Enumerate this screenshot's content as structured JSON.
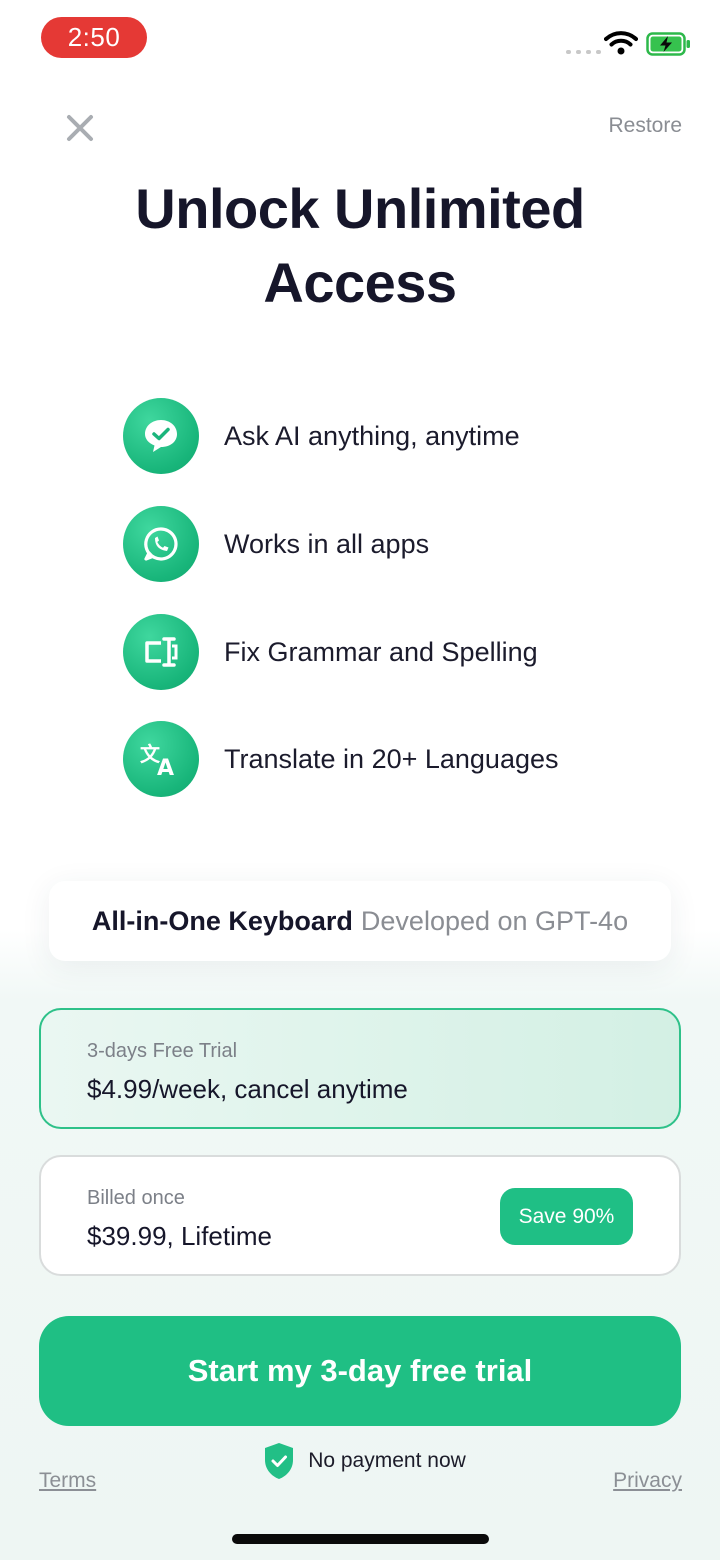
{
  "status_bar": {
    "time": "2:50",
    "wifi_icon": "wifi-icon",
    "battery_icon": "battery-charging-icon"
  },
  "header": {
    "close_icon": "close-icon",
    "restore_label": "Restore"
  },
  "title": "Unlock Unlimited Access",
  "features": [
    {
      "icon": "chat-check-icon",
      "label": "Ask AI anything, anytime"
    },
    {
      "icon": "whatsapp-icon",
      "label": "Works in all apps"
    },
    {
      "icon": "text-cursor-icon",
      "label": "Fix Grammar and Spelling"
    },
    {
      "icon": "translate-icon",
      "label": "Translate in 20+ Languages"
    }
  ],
  "banner": {
    "bold": "All-in-One Keyboard",
    "light": "Developed on GPT-4o"
  },
  "plans": [
    {
      "subtitle": "3-days Free Trial",
      "price": "$4.99/week, cancel anytime",
      "selected": true
    },
    {
      "subtitle": "Billed once",
      "price": "$39.99, Lifetime",
      "badge": "Save 90%",
      "selected": false
    }
  ],
  "cta_label": "Start my 3-day free trial",
  "no_payment": {
    "icon": "shield-check-icon",
    "label": "No payment now"
  },
  "footer": {
    "terms": "Terms",
    "privacy": "Privacy"
  },
  "colors": {
    "accent": "#1fbf84",
    "time_pill": "#e53935",
    "text": "#16162a",
    "muted": "#8a8d93"
  }
}
